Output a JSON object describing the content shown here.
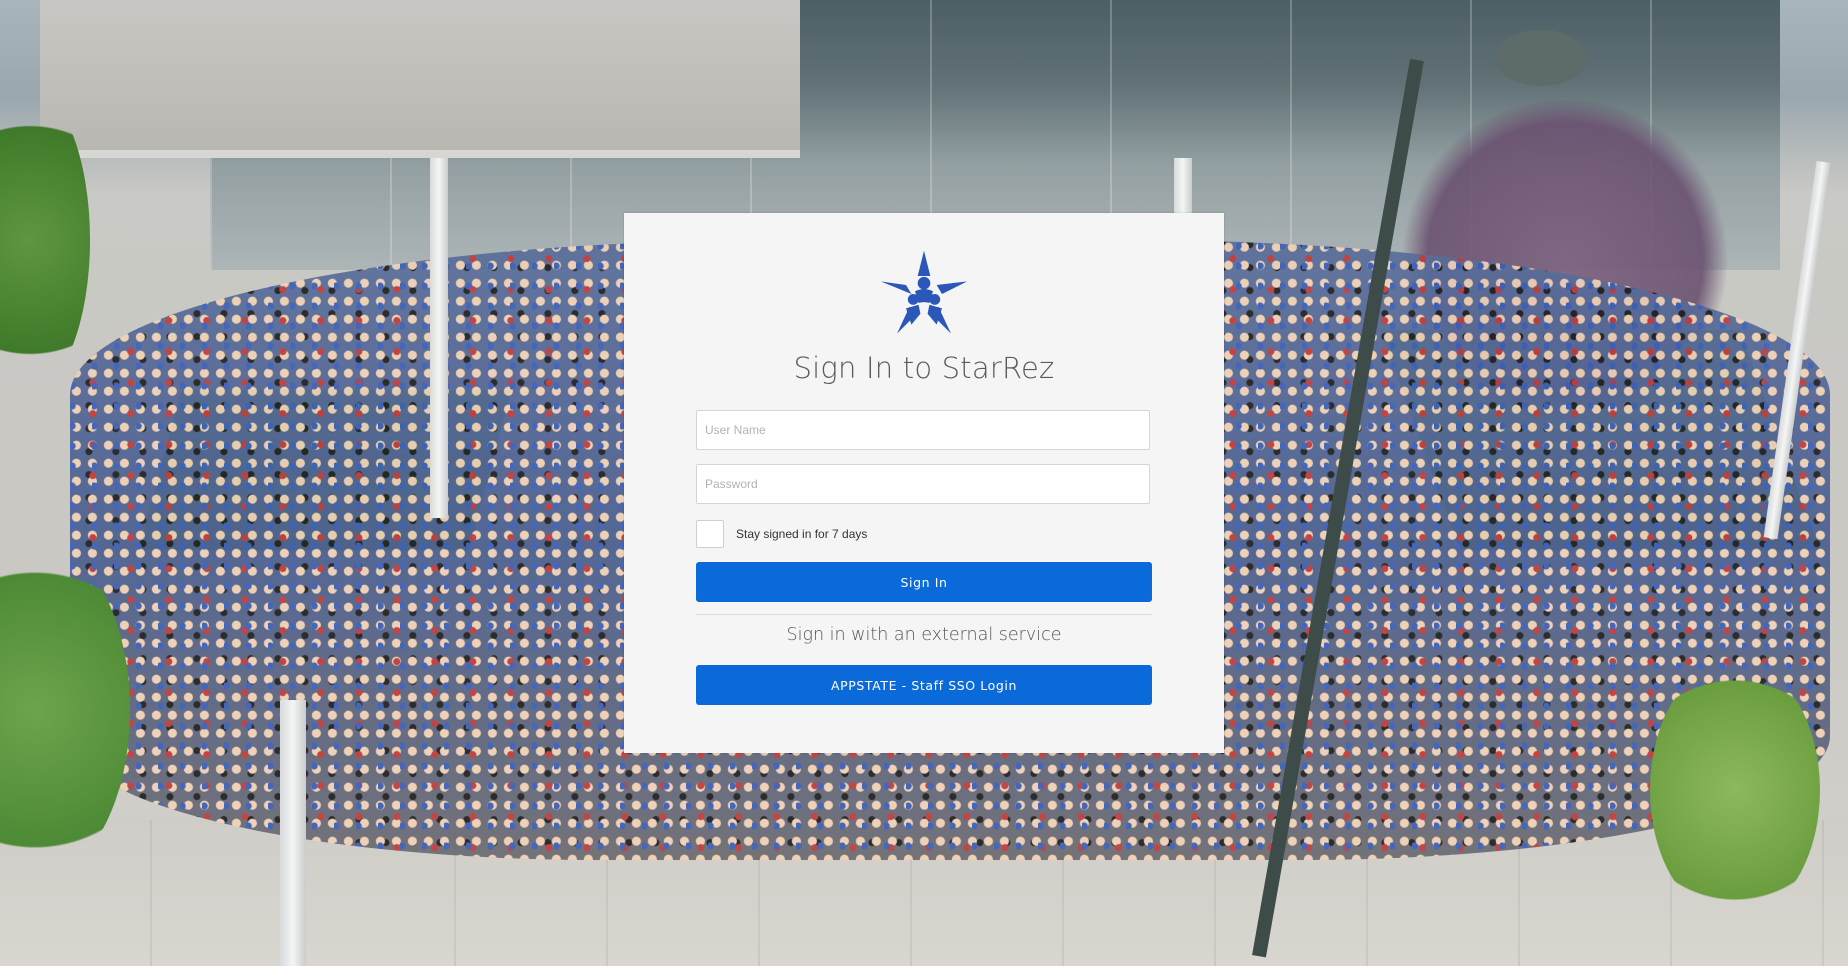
{
  "login": {
    "title": "Sign In to StarRez",
    "username_placeholder": "User Name",
    "username_value": "",
    "password_placeholder": "Password",
    "password_value": "",
    "remember_label": "Stay signed in for 7 days",
    "remember_checked": false,
    "signin_label": "Sign In",
    "external_label": "Sign in with an external service",
    "sso_label": "APPSTATE - Staff SSO Login"
  },
  "colors": {
    "primary_button": "#0a6ad9",
    "logo_blue": "#2b58b8",
    "card_background": "#f5f5f5"
  },
  "icons": {
    "logo": "starrez-star-people-logo"
  }
}
